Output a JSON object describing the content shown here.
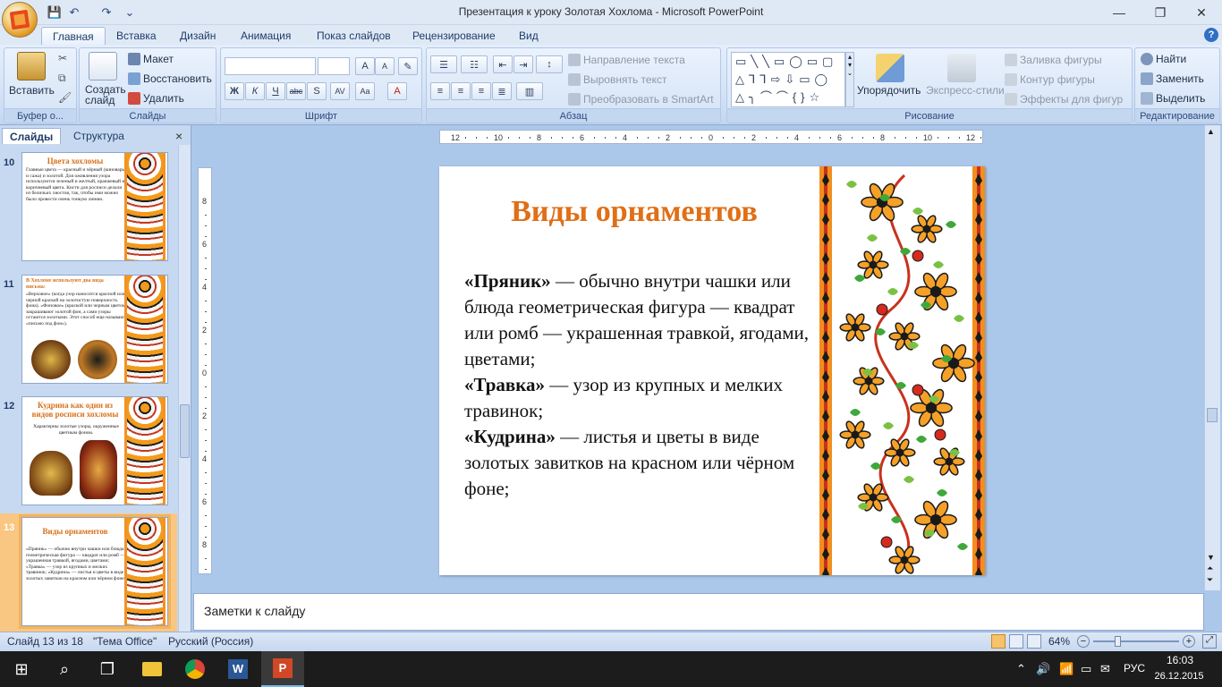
{
  "window": {
    "title": "Презентация к уроку Золотая Хохлома - Microsoft PowerPoint",
    "min_label": "—",
    "max_label": "❐",
    "close_label": "✕"
  },
  "quick_access": [
    "💾",
    "↶",
    "↷",
    "⌄"
  ],
  "tabs": [
    "Главная",
    "Вставка",
    "Дизайн",
    "Анимация",
    "Показ слайдов",
    "Рецензирование",
    "Вид"
  ],
  "ribbon": {
    "clipboard": {
      "label": "Буфер о...",
      "paste": "Вставить"
    },
    "slides": {
      "label": "Слайды",
      "new_slide": "Создать слайд",
      "layout": "Макет",
      "reset": "Восстановить",
      "delete": "Удалить"
    },
    "font": {
      "label": "Шрифт",
      "bold": "Ж",
      "italic": "К",
      "underline": "Ч",
      "strike": "abc",
      "shadow": "S",
      "spacing": "AV",
      "case": "Aa",
      "color": "A",
      "grow": "A",
      "shrink": "A"
    },
    "paragraph": {
      "label": "Абзац",
      "text_direction": "Направление текста",
      "align_text": "Выровнять текст",
      "smartart": "Преобразовать в SmartArt"
    },
    "drawing": {
      "label": "Рисование",
      "arrange": "Упорядочить",
      "quick_styles": "Экспресс-стили",
      "fill": "Заливка фигуры",
      "outline": "Контур фигуры",
      "effects": "Эффекты для фигур"
    },
    "editing": {
      "label": "Редактирование",
      "find": "Найти",
      "replace": "Заменить",
      "select": "Выделить"
    }
  },
  "left_pane": {
    "tab_slides": "Слайды",
    "tab_outline": "Структура",
    "close": "×",
    "thumbnails": [
      {
        "num": "10",
        "title": "Цвета хохломы",
        "text": "Главные цвета — красный и чёрный (киноварь и сажа) и золотой. Для оживления узора используются зеленый и желтый, оранжевый и коричневый цвета. Кисти для росписи делали из беличьих хвостов, так, чтобы ими можно было провести очень тонкую линию."
      },
      {
        "num": "11",
        "title": "В Хохломе используют два вида письма:",
        "text": "«Верховое» (когда узор наносится красной или черной краской на золотистую поверхность фона). «Фоновое» (краской или черным цветом закрашивают золотой фон, а сами узоры остаются золотыми. Этот способ еще называют «письмо под фон»)."
      },
      {
        "num": "12",
        "title": "Кудрина как один из видов росписи хохломы",
        "text": "Характерны золотые узоры, окруженные цветным фоном."
      },
      {
        "num": "13",
        "title": "Виды орнаментов",
        "text": "«Пряник» — обычно внутри чашки или блюда геометрическая фигура — квадрат или ромб — украшенная травкой, ягодами, цветами; «Травка» — узор из крупных и мелких травинок; «Кудрина» — листья и цветы в виде золотых завитков на красном или чёрном фоне;"
      }
    ]
  },
  "slide": {
    "title": "Виды орнаментов",
    "items": [
      {
        "term": "«Пряник»",
        "desc": " — обычно внутри чашки или блюда геометрическая фигура — квадрат или ромб — украшенная травкой, ягодами, цветами;"
      },
      {
        "term": "«Травка»",
        "desc": " — узор из крупных и мелких травинок;"
      },
      {
        "term": "«Кудрина»",
        "desc": " — листья и цветы в виде золотых завитков на красном или чёрном фоне;"
      }
    ]
  },
  "ruler": {
    "h_ticks": [
      "12",
      "10",
      "8",
      "6",
      "4",
      "2",
      "0",
      "2",
      "4",
      "6",
      "8",
      "10",
      "12"
    ],
    "v_ticks": [
      "8",
      "6",
      "4",
      "2",
      "0",
      "2",
      "4",
      "6",
      "8"
    ]
  },
  "notes": {
    "placeholder": "Заметки к слайду"
  },
  "status": {
    "slide_of": "Слайд 13 из 18",
    "theme": "\"Тема Office\"",
    "language": "Русский (Россия)",
    "zoom": "64%"
  },
  "taskbar": {
    "lang": "РУС",
    "time": "16:03",
    "date": "26.12.2015"
  },
  "colors": {
    "accent_orange": "#e06f16",
    "ribbon_blue": "#d5e3f6",
    "taskbar": "#1c1c1c"
  }
}
